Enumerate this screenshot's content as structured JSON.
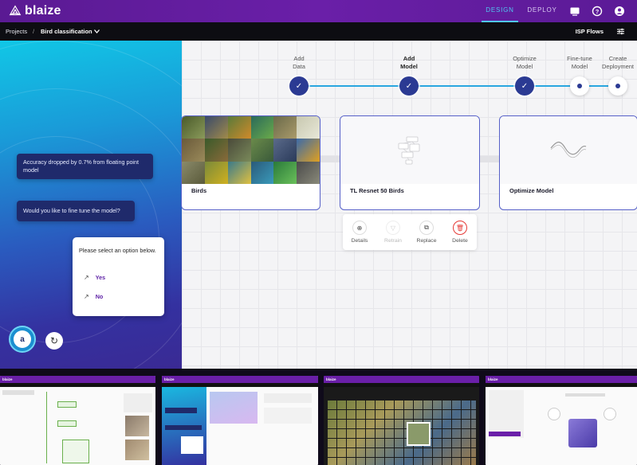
{
  "app": {
    "logo_text": "blaize",
    "nav": [
      {
        "label": "DESIGN",
        "active": true
      },
      {
        "label": "DEPLOY",
        "active": false
      }
    ],
    "icons": [
      "display-icon",
      "help-icon",
      "account-icon"
    ],
    "accent_color": "#51c7f2",
    "brand_color": "#6a1fa8"
  },
  "breadcrumb": {
    "projects": "Projects",
    "separator": "/",
    "current": "Bird classification",
    "dropdown_icon": "chevron-down-icon"
  },
  "toolbar": {
    "isp_flows": "ISP Flows",
    "settings_icon": "sliders-icon"
  },
  "chat": {
    "messages": [
      "Accuracy dropped by 0.7% from floating point model",
      "Would you like to fine tune the model?"
    ],
    "prompt": "Please select an option below.",
    "options": [
      "Yes",
      "No"
    ],
    "assistant_initial": "a"
  },
  "steps": [
    {
      "label_line1": "Add",
      "label_line2": "Data",
      "status": "done",
      "bold": false
    },
    {
      "label_line1": "Add",
      "label_line2": "Model",
      "status": "done",
      "bold": true
    },
    {
      "label_line1": "Optimize",
      "label_line2": "Model",
      "status": "done",
      "bold": false
    },
    {
      "label_line1": "Fine-tune",
      "label_line2": "Model",
      "status": "pending",
      "bold": false
    },
    {
      "label_line1": "Create",
      "label_line2": "Deployment",
      "status": "pending",
      "bold": false
    }
  ],
  "cards": [
    {
      "title": "Birds"
    },
    {
      "title": "TL Resnet 50 Birds"
    },
    {
      "title": "Optimize Model"
    }
  ],
  "actions": [
    {
      "label": "Details",
      "icon": "zoom-in-icon",
      "disabled": false
    },
    {
      "label": "Retrain",
      "icon": "funnel-icon",
      "disabled": true
    },
    {
      "label": "Replace",
      "icon": "copy-icon",
      "disabled": false
    },
    {
      "label": "Delete",
      "icon": "trash-icon",
      "disabled": false
    }
  ],
  "thumbnails": [
    {
      "logo": "blaize"
    },
    {
      "logo": "blaize"
    },
    {
      "logo": "blaize"
    },
    {
      "logo": "blaize"
    }
  ]
}
